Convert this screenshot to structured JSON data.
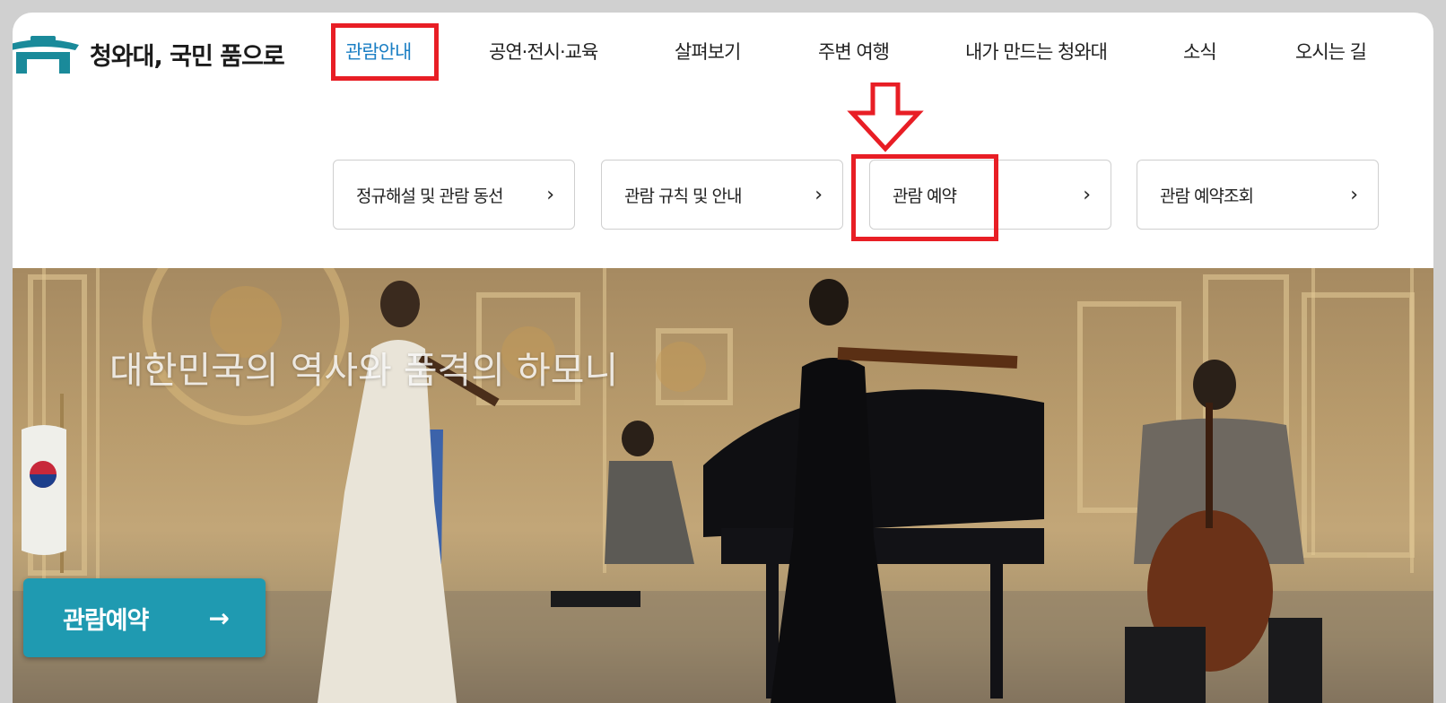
{
  "site": {
    "logo_text": "청와대, 국민 품으로"
  },
  "nav": {
    "items": [
      {
        "label": "관람안내"
      },
      {
        "label": "공연·전시·교육"
      },
      {
        "label": "살펴보기"
      },
      {
        "label": "주변 여행"
      },
      {
        "label": "내가 만드는 청와대"
      },
      {
        "label": "소식"
      },
      {
        "label": "오시는 길"
      }
    ]
  },
  "submenu": {
    "items": [
      {
        "label": "정규해설 및 관람 동선",
        "chevron": "›"
      },
      {
        "label": "관람 규칙 및 안내",
        "chevron": "›"
      },
      {
        "label": "관람 예약",
        "chevron": "›"
      },
      {
        "label": "관람 예약조회",
        "chevron": "›"
      }
    ]
  },
  "hero": {
    "headline": "대한민국의 역사와 품격의 하모니",
    "cta_label": "관람예약",
    "cta_arrow": "→"
  },
  "colors": {
    "accent": "#1b7fc4",
    "cta": "#1f9ab1",
    "annotation": "#e81e25",
    "logo": "#1a8a9a"
  },
  "icons": [
    "roof-logo-icon",
    "chevron-right-icon",
    "arrow-right-icon",
    "down-arrow-annotation-icon"
  ]
}
